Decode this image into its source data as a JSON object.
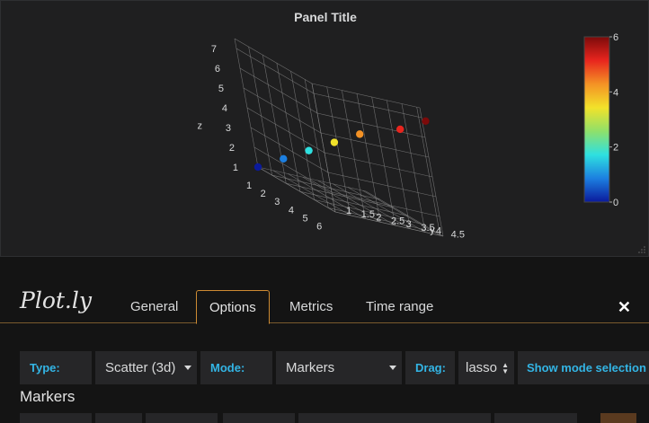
{
  "panel": {
    "title": "Panel Title"
  },
  "chart_data": {
    "type": "scatter",
    "mode": "markers",
    "x": [
      1,
      2,
      3,
      4,
      5,
      6,
      7
    ],
    "y": [
      1,
      1.5,
      2,
      2.5,
      3,
      4,
      4.5
    ],
    "z": [
      1,
      2,
      3,
      4,
      5,
      6,
      7
    ],
    "color": [
      0,
      1,
      2,
      3,
      4,
      5,
      6
    ],
    "colorscale": [
      "#0b1a9c",
      "#1c7fe0",
      "#2ee0e0",
      "#8fe06a",
      "#f2e22a",
      "#f49225",
      "#e8251e",
      "#7c0a0a"
    ],
    "colorbar": {
      "range": [
        0,
        6
      ],
      "tick_labels": [
        "0",
        "2",
        "4",
        "6"
      ]
    },
    "xaxis": {
      "tick_labels": [
        "1",
        "2",
        "3",
        "4",
        "5",
        "6"
      ]
    },
    "yaxis": {
      "label": "y",
      "tick_labels": [
        "1",
        "1.5",
        "2",
        "2.5",
        "3",
        "3.5",
        "4",
        "4.5"
      ]
    },
    "zaxis": {
      "label": "z",
      "tick_labels": [
        "1",
        "2",
        "3",
        "4",
        "5",
        "6",
        "7"
      ]
    },
    "grid": true
  },
  "editor": {
    "plugin_title": "Plot.ly",
    "tabs": [
      {
        "label": "General"
      },
      {
        "label": "Options"
      },
      {
        "label": "Metrics"
      },
      {
        "label": "Time range"
      }
    ],
    "active_tab": "Options",
    "close_icon": "close-icon",
    "type_label": "Type:",
    "type_value": "Scatter (3d)",
    "mode_label": "Mode:",
    "mode_value": "Markers",
    "drag_label": "Drag:",
    "drag_value": "lasso",
    "show_mode_link": "Show mode selection t",
    "section_markers": "Markers"
  },
  "colors": {
    "accent_orange": "#ce8b33",
    "link_blue": "#33b5e5",
    "panel_bg": "#1f1f20",
    "editor_bg": "#141414"
  }
}
